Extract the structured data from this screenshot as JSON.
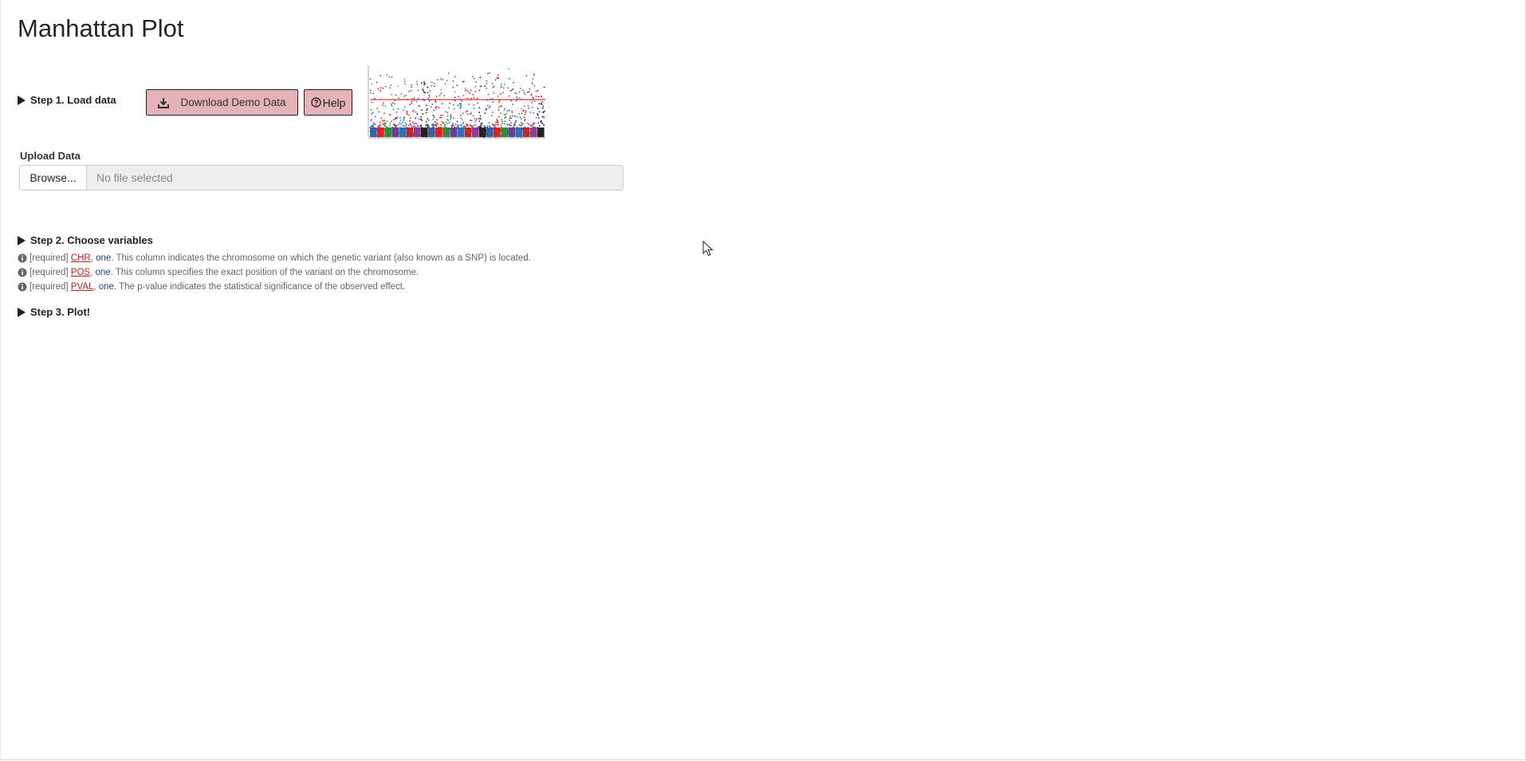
{
  "page": {
    "title": "Manhattan Plot"
  },
  "steps": {
    "step1": {
      "label": "Step 1. Load data"
    },
    "step2": {
      "label": "Step 2. Choose variables"
    },
    "step3": {
      "label": "Step 3. Plot!"
    }
  },
  "toolbar": {
    "download_label": "Download Demo Data",
    "download_icon": "download-icon",
    "help_label": "Help",
    "help_icon": "question-circle-icon"
  },
  "upload": {
    "label": "Upload Data",
    "browse_label": "Browse...",
    "file_status": "No file selected"
  },
  "variables": [
    {
      "tag": "[required]",
      "name": "CHR",
      "sep": ",",
      "count": "one",
      "description": ". This column indicates the chromosome on which the genetic variant (also known as a SNP) is located."
    },
    {
      "tag": "[required]",
      "name": "POS",
      "sep": ",",
      "count": "one",
      "description": ". This column specifies the exact position of the variant on the chromosome."
    },
    {
      "tag": "[required]",
      "name": "PVAL",
      "sep": ",",
      "count": "one",
      "description": ". The p-value indicates the statistical significance of the observed effect."
    }
  ],
  "colors": {
    "button_bg": "#e4b2b8",
    "variable_name": "#b22222",
    "variable_count": "#1f3f9a",
    "threshold_line": "#e03030",
    "chromosome_palette": [
      "#3b5ea8",
      "#e02020",
      "#2e8b3e",
      "#6a3d9a",
      "#2f6fb3",
      "#c0282e",
      "#8a3f8f",
      "#222222"
    ]
  }
}
